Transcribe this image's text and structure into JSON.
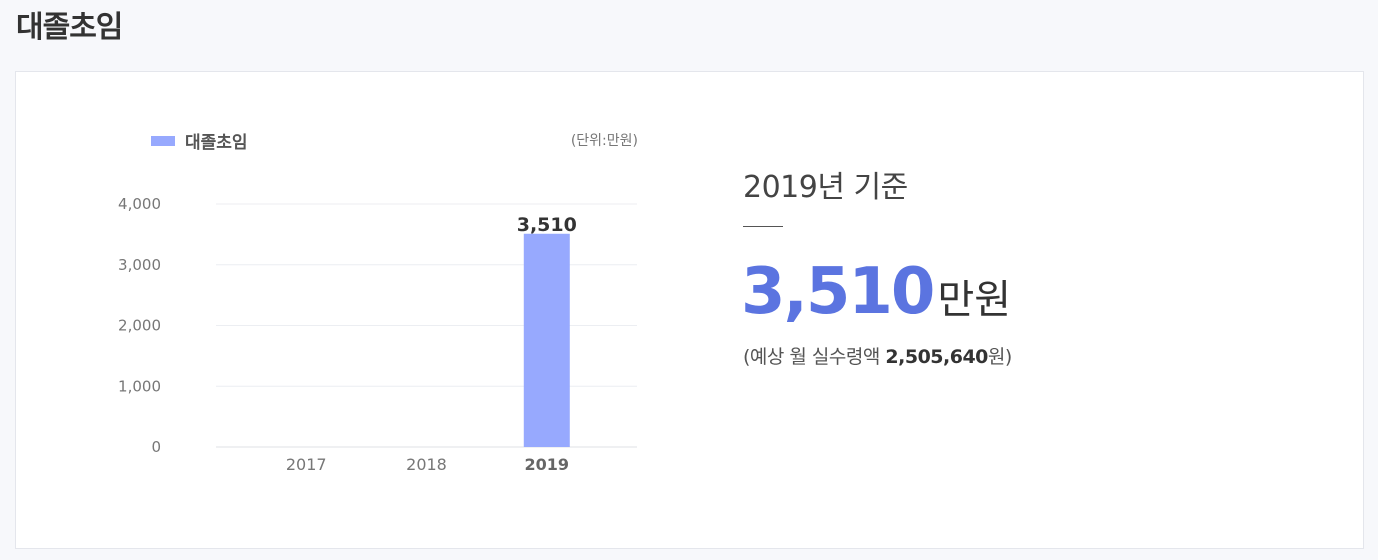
{
  "page": {
    "title": "대졸초임"
  },
  "legend": {
    "label": "대졸초임",
    "color": "#97a9fe"
  },
  "unit_label": "(단위:만원)",
  "info": {
    "year_label": "2019년 기준",
    "amount_value": "3,510",
    "amount_unit": "만원",
    "monthly_prefix": "(예상 월 실수령액 ",
    "monthly_value": "2,505,640",
    "monthly_suffix": "원)",
    "accent_color": "#5b74e0"
  },
  "chart_data": {
    "type": "bar",
    "categories": [
      "2017",
      "2018",
      "2019"
    ],
    "series": [
      {
        "name": "대졸초임",
        "values": [
          null,
          null,
          3510
        ]
      }
    ],
    "data_labels": [
      "",
      "",
      "3,510"
    ],
    "highlight_category": "2019",
    "yticks": [
      "0",
      "1,000",
      "2,000",
      "3,000",
      "4,000"
    ],
    "ylim": [
      0,
      4000
    ],
    "grid": true,
    "legend_position": "top-left",
    "bar_color": "#97a9fe"
  }
}
